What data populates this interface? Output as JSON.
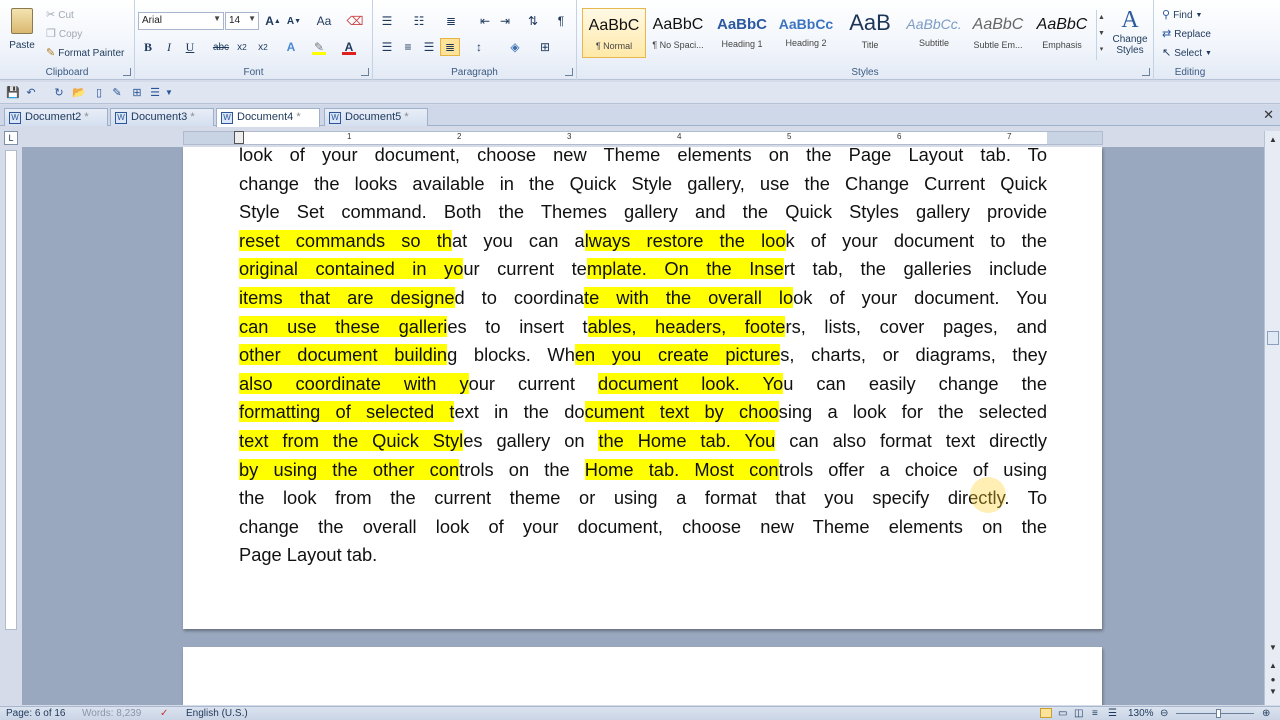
{
  "clipboard": {
    "paste": "Paste",
    "cut": "Cut",
    "copy": "Copy",
    "format_painter": "Format Painter",
    "label": "Clipboard"
  },
  "font": {
    "family": "Arial",
    "size": "14",
    "label": "Font",
    "case_label": "Aa"
  },
  "paragraph": {
    "label": "Paragraph"
  },
  "styles": {
    "label": "Styles",
    "items": [
      {
        "sample": "AaBbC",
        "name": "¶ Normal"
      },
      {
        "sample": "AaBbC",
        "name": "¶ No Spaci..."
      },
      {
        "sample": "AaBbC",
        "name": "Heading 1"
      },
      {
        "sample": "AaBbCc",
        "name": "Heading 2"
      },
      {
        "sample": "AaB",
        "name": "Title"
      },
      {
        "sample": "AaBbCc.",
        "name": "Subtitle"
      },
      {
        "sample": "AaBbC",
        "name": "Subtle Em..."
      },
      {
        "sample": "AaBbC",
        "name": "Emphasis"
      }
    ],
    "change_styles": "Change Styles"
  },
  "editing": {
    "label": "Editing",
    "find": "Find",
    "replace": "Replace",
    "select": "Select"
  },
  "tabs": [
    "Document2",
    "Document3",
    "Document4",
    "Document5"
  ],
  "document": {
    "lines": [
      [
        [
          "look of your document, choose new Theme elements on the Page Layout tab. To",
          false
        ]
      ],
      [
        [
          "change the looks available in the Quick Style gallery, use the Change Current Quick",
          false
        ]
      ],
      [
        [
          "Style Set command. Both the Themes gallery and the Quick Styles gallery provide",
          false
        ]
      ],
      [
        [
          "reset commands so th",
          true
        ],
        [
          "at you can a",
          false
        ],
        [
          "lways restore the loo",
          true
        ],
        [
          "k of your document to the",
          false
        ]
      ],
      [
        [
          "original contained in yo",
          true
        ],
        [
          "ur current te",
          false
        ],
        [
          "mplate. On the Inse",
          true
        ],
        [
          "rt tab, the galleries include",
          false
        ]
      ],
      [
        [
          "items that are designe",
          true
        ],
        [
          "d to coordina",
          false
        ],
        [
          "te with the overall lo",
          true
        ],
        [
          "ok of your document. You",
          false
        ]
      ],
      [
        [
          "can use these galleri",
          true
        ],
        [
          "es to insert t",
          false
        ],
        [
          "ables, headers, foote",
          true
        ],
        [
          "rs, lists, cover pages, and",
          false
        ]
      ],
      [
        [
          "other document buildin",
          true
        ],
        [
          "g blocks. Wh",
          false
        ],
        [
          "en you create picture",
          true
        ],
        [
          "s, charts, or diagrams, they",
          false
        ]
      ],
      [
        [
          "also coordinate with y",
          true
        ],
        [
          "our current ",
          false
        ],
        [
          "document look. Yo",
          true
        ],
        [
          "u can easily change the",
          false
        ]
      ],
      [
        [
          "formatting of selected t",
          true
        ],
        [
          "ext in the do",
          false
        ],
        [
          "cument text by choo",
          true
        ],
        [
          "sing a look for the selected",
          false
        ]
      ],
      [
        [
          "text from the Quick Styl",
          true
        ],
        [
          "es gallery on ",
          false
        ],
        [
          "the Home tab. You",
          true
        ],
        [
          " can also format text directly",
          false
        ]
      ],
      [
        [
          "by using the other con",
          true
        ],
        [
          "trols on the ",
          false
        ],
        [
          "Home tab. Most con",
          true
        ],
        [
          "trols offer a choice of using",
          false
        ]
      ],
      [
        [
          "the look from the current theme or using a format that you specify directly. To",
          false
        ]
      ],
      [
        [
          "change the overall look of your document, choose new Theme elements on the",
          false
        ]
      ],
      [
        [
          "Page Layout tab.",
          false
        ]
      ]
    ]
  },
  "status": {
    "page": "Page: 6 of 16",
    "words": "Words: 8,239",
    "language": "English (U.S.)",
    "zoom": "130%"
  }
}
